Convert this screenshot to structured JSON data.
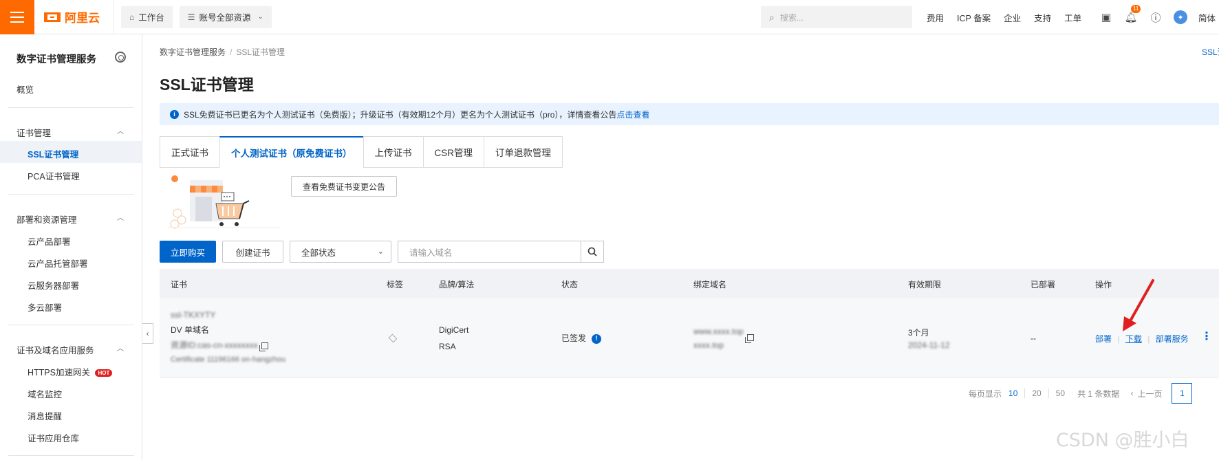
{
  "topbar": {
    "logo_text": "阿里云",
    "workbench_label": "工作台",
    "resources_label": "账号全部资源",
    "search_placeholder": "搜索...",
    "links": [
      "费用",
      "ICP 备案",
      "企业",
      "支持",
      "工单"
    ],
    "notification_count": "11",
    "lang_label": "简体"
  },
  "sidebar": {
    "title": "数字证书管理服务",
    "overview": "概览",
    "groups": [
      {
        "label": "证书管理",
        "items": [
          "SSL证书管理",
          "PCA证书管理"
        ]
      },
      {
        "label": "部署和资源管理",
        "items": [
          "云产品部署",
          "云产品托管部署",
          "云服务器部署",
          "多云部署"
        ]
      },
      {
        "label": "证书及域名应用服务",
        "items": [
          "HTTPS加速网关",
          "域名监控",
          "消息提醒",
          "证书应用仓库"
        ]
      }
    ],
    "hot_badge": "HOT"
  },
  "main": {
    "breadcrumb_root": "数字证书管理服务",
    "breadcrumb_current": "SSL证书管理",
    "corner_link": "SSL证书",
    "title": "SSL证书管理",
    "notice_text": "SSL免费证书已更名为个人测试证书（免费版）；升级证书（有效期12个月）更名为个人测试证书（pro），详情查看公告",
    "notice_link": "点击查看",
    "tabs": [
      "正式证书",
      "个人测试证书（原免费证书）",
      "上传证书",
      "CSR管理",
      "订单退款管理"
    ],
    "notice_button": "查看免费证书变更公告",
    "buy_button": "立即购买",
    "create_button": "创建证书",
    "status_select": "全部状态",
    "domain_placeholder": "请输入域名"
  },
  "table": {
    "headers": [
      "证书",
      "标签",
      "品牌/算法",
      "状态",
      "绑定域名",
      "有效期限",
      "已部署",
      "操作"
    ],
    "row": {
      "cert_name": "ssl-TKXYTY",
      "cert_type": "DV 单域名",
      "resource_id": "资源ID:cas-cn-xxxxxxxx",
      "order_id": "Certificate 11196166 on-hangzhou",
      "brand": "DigiCert",
      "algorithm": "RSA",
      "status": "已签发",
      "domain_1": "www.xxxx.top",
      "domain_2": "xxxx.top",
      "validity": "3个月",
      "validity_date": "2024-11-12",
      "deployed": "--",
      "actions": [
        "部署",
        "下载",
        "部署服务"
      ]
    }
  },
  "pagination": {
    "per_page_label": "每页显示",
    "sizes": [
      "10",
      "20",
      "50"
    ],
    "total": "共 1 条数据",
    "prev": "上一页",
    "page": "1"
  },
  "watermark": "CSDN @胜小白",
  "colors": {
    "accent": "#0064c8",
    "brand": "#ff6a00",
    "arrow": "#e02020"
  }
}
